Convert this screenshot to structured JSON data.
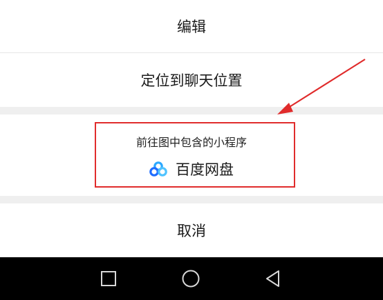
{
  "menu": {
    "edit_label": "编辑",
    "locate_label": "定位到聊天位置",
    "miniapp_heading": "前往图中包含的小程序",
    "miniapp_name": "百度网盘",
    "miniapp_icon": "baidu-netdisk-cloud-icon",
    "cancel_label": "取消"
  },
  "navbar": {
    "recent_icon": "square-recent-apps-icon",
    "home_icon": "circle-home-icon",
    "back_icon": "triangle-back-icon"
  },
  "annotation": {
    "highlight_color": "#e02b2b"
  }
}
